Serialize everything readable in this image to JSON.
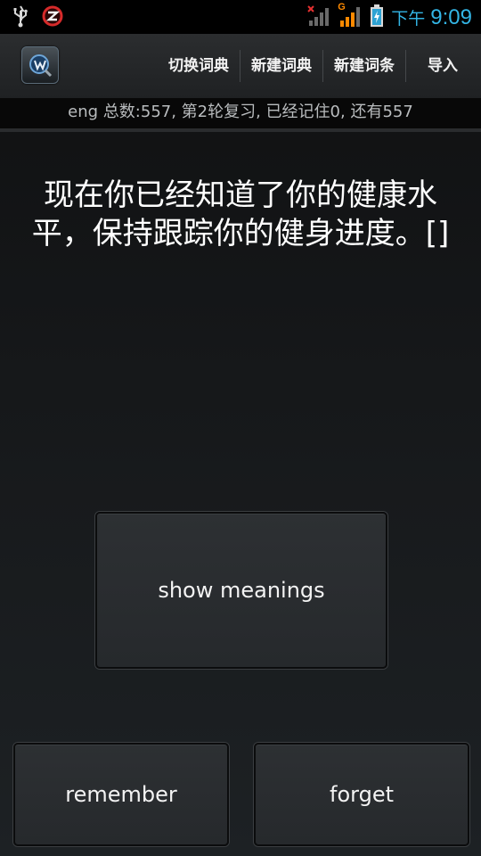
{
  "status_bar": {
    "icons": [
      "usb-icon",
      "zapya-icon",
      "signal-no-sim-icon",
      "signal-g-icon",
      "battery-charging-icon"
    ],
    "network_type": "G",
    "ampm": "下午",
    "time": "9:09",
    "accent_color": "#33b5e5"
  },
  "action_bar": {
    "logo_icon": "app-logo-icon",
    "actions": [
      {
        "label": "切换词典"
      },
      {
        "label": "新建词典"
      },
      {
        "label": "新建词条"
      },
      {
        "label": "导入"
      }
    ]
  },
  "info": {
    "text": "eng 总数:557, 第2轮复习, 已经记住0, 还有557"
  },
  "word": {
    "text": "现在你已经知道了你的健康水平，保持跟踪你的健身进度。[]"
  },
  "buttons": {
    "show_meanings": "show meanings",
    "remember": "remember",
    "forget": "forget"
  }
}
